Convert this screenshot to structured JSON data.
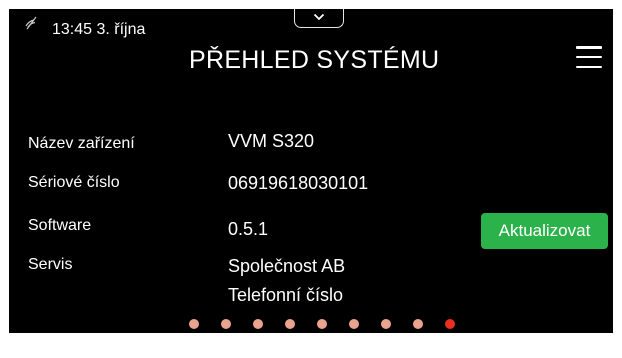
{
  "status_bar": {
    "time_date": "13:45 3. října",
    "icon": "no-signal-icon"
  },
  "header": {
    "title": "PŘEHLED SYSTÉMU",
    "pull_tab_icon": "chevron-down-icon",
    "menu_icon": "hamburger-menu-icon"
  },
  "info": {
    "device_name_label": "Název zařízení",
    "device_name_value": "VVM S320",
    "serial_label": "Sériové číslo",
    "serial_value": "06919618030101",
    "software_label": "Software",
    "software_value": "0.5.1",
    "service_label": "Servis",
    "service_company": "Společnost AB",
    "service_phone": "Telefonní číslo"
  },
  "update_button": {
    "label": "Aktualizovat"
  },
  "pagination": {
    "total_pages": 9,
    "active_page": 9
  },
  "colors": {
    "background": "#000000",
    "text": "#ffffff",
    "update_button": "#2bb24a",
    "dot_inactive": "#e8a58e",
    "dot_active": "#e8301c"
  }
}
